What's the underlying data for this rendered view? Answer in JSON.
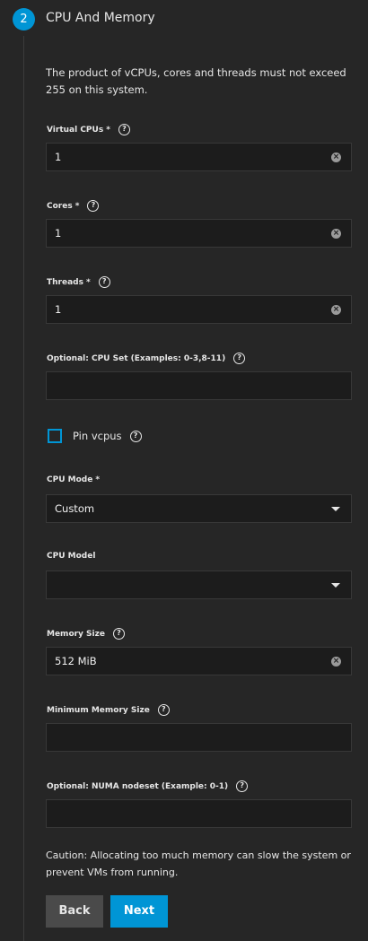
{
  "step": {
    "number": "2",
    "title": "CPU And Memory"
  },
  "intro": "The product of vCPUs, cores and threads must not exceed 255 on this system.",
  "fields": {
    "vcpus": {
      "label": "Virtual CPUs",
      "required": "*",
      "value": "1"
    },
    "cores": {
      "label": "Cores",
      "required": "*",
      "value": "1"
    },
    "threads": {
      "label": "Threads",
      "required": "*",
      "value": "1"
    },
    "cpu_set": {
      "label": "Optional: CPU Set (Examples: 0-3,8-11)",
      "value": ""
    },
    "pin_vcpus": {
      "label": "Pin vcpus",
      "checked": false
    },
    "cpu_mode": {
      "label": "CPU Mode",
      "required": "*",
      "value": "Custom"
    },
    "cpu_model": {
      "label": "CPU Model",
      "value": ""
    },
    "memory_size": {
      "label": "Memory Size",
      "value": "512 MiB"
    },
    "min_memory": {
      "label": "Minimum Memory Size",
      "value": ""
    },
    "numa_nodeset": {
      "label": "Optional: NUMA nodeset (Example: 0-1)",
      "value": ""
    }
  },
  "help_glyph": "?",
  "clear_glyph": "×",
  "caution": "Caution: Allocating too much memory can slow the system or prevent VMs from running.",
  "buttons": {
    "back": "Back",
    "next": "Next"
  },
  "colors": {
    "accent": "#0095d5",
    "background": "#262626",
    "input_bg": "#1c1c1c"
  }
}
